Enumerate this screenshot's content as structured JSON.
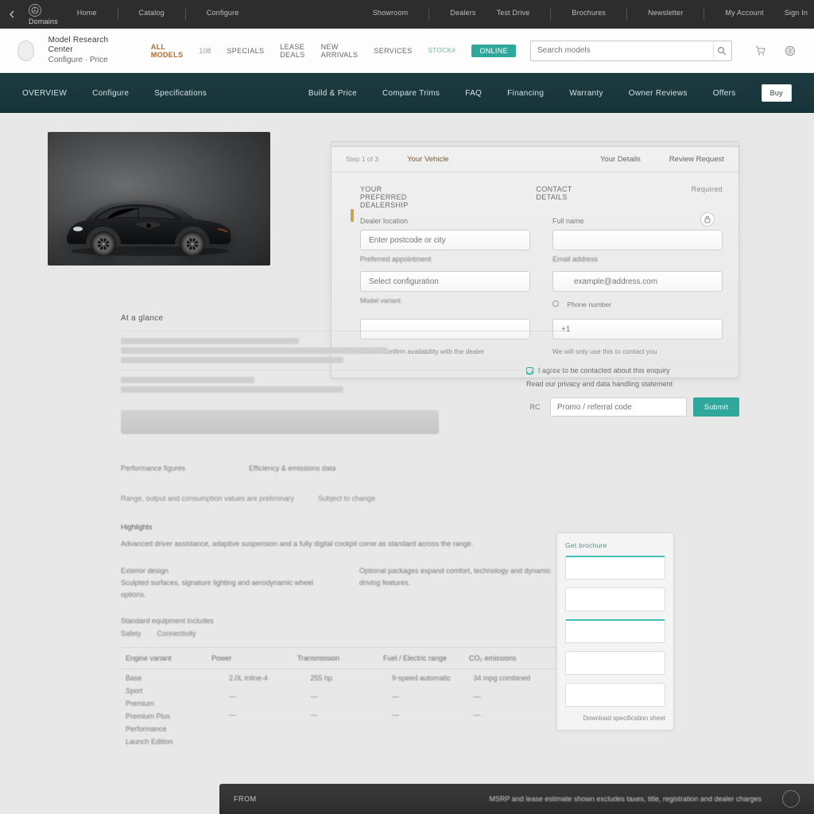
{
  "topbar": {
    "brand": "Domains",
    "links": [
      "Home",
      "Catalog",
      "Configure"
    ],
    "right": [
      "Showroom",
      "Dealers",
      "Test Drive",
      "Brochures",
      "Newsletter",
      "My Account",
      "Sign In"
    ]
  },
  "header": {
    "title_line1": "Model Research Center",
    "title_line2": "Configure · Price",
    "mid": [
      {
        "label": "ALL MODELS",
        "count": "108",
        "accent": true
      },
      {
        "label": "SPECIALS",
        "icon": "tag"
      },
      {
        "label": "LEASE DEALS",
        "icon": "percent"
      },
      {
        "label": "NEW ARRIVALS"
      },
      {
        "label": "SERVICES"
      }
    ],
    "badge_key": "STOCK#",
    "badge": "ONLINE",
    "search_placeholder": "Search models"
  },
  "nav": {
    "items": [
      "OVERVIEW",
      "Configure",
      "Specifications",
      "Build & Price",
      "Compare Trims",
      "FAQ",
      "Financing",
      "Warranty",
      "Owner Reviews",
      "Offers"
    ],
    "cta": "Buy"
  },
  "card": {
    "tabbar": "Step 1 of 3",
    "tabs": [
      "Your Vehicle",
      "Your Details",
      "Review Request"
    ],
    "active_tab": 0,
    "section_a": "YOUR PREFERRED DEALERSHIP",
    "section_b": "CONTACT DETAILS",
    "right_hint": "Required",
    "left_field1_label": "Dealer location",
    "left_field1_ph": "Enter postcode or city",
    "left_field2_label": "Preferred appointment",
    "left_field3_label": "Model variant",
    "left_field3_ph": "Select configuration",
    "right_field1_label": "Full name",
    "right_field1_ph": "",
    "right_sub_label": "Email address",
    "right_field2_ph": "example@address.com",
    "right_field3_label": "Phone number",
    "right_field3_ph": "+1",
    "note_left": "We will confirm availability with the dealer",
    "note_right": "We will only use this to contact you"
  },
  "consent": {
    "line1": "I agree to be contacted about this enquiry",
    "line2": "Read our privacy and data handling statement",
    "prefix": "RC",
    "input_ph": "Promo / referral code",
    "button": "Submit"
  },
  "doc": {
    "title": "At a glance",
    "pair": [
      "Performance figures",
      "Efficiency & emissions data"
    ],
    "midline1": "Range, output and consumption values are preliminary",
    "midline2": "Subject to change",
    "h1": "Highlights",
    "p1": "Advanced driver assistance, adaptive suspension and a fully digital cockpit come as standard across the range.",
    "colA_h": "Exterior design",
    "colA": "Sculpted surfaces, signature lighting and aerodynamic wheel options.",
    "colB_h": "",
    "colB": "Optional packages expand comfort, technology and dynamic driving features.",
    "small_h": "Standard equipment includes",
    "small_row": [
      "Safety",
      "Connectivity"
    ]
  },
  "table": {
    "headers": [
      "Engine variant",
      "Power",
      "Transmission",
      "Fuel / Electric range",
      "CO₂ emissions"
    ],
    "side_labels": [
      "Base",
      "Sport",
      "Premium",
      "Premium Plus",
      "Performance",
      "Launch Edition"
    ],
    "row1": [
      "",
      "2.0L inline-4",
      "255 hp",
      "9-speed automatic",
      "34 mpg combined"
    ]
  },
  "sidecard": {
    "title": "Get brochure",
    "footer": "Download specification sheet"
  },
  "bottombar": {
    "left": "FROM",
    "text": "MSRP and lease estimate shown excludes taxes, title, registration and dealer charges",
    "price": ""
  }
}
